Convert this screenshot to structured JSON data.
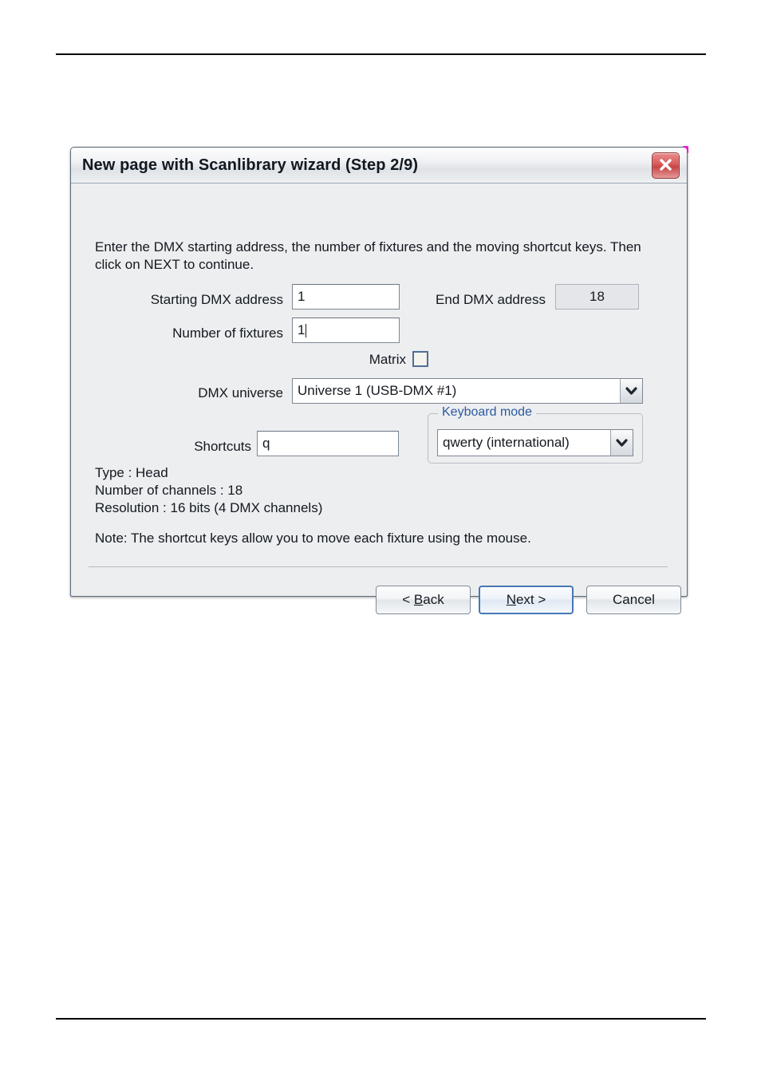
{
  "dialog": {
    "title": "New page with Scanlibrary wizard (Step 2/9)",
    "close_icon": "close-icon",
    "instruction": "Enter the DMX starting address, the number of fixtures and the moving shortcut keys. Then click on NEXT to continue.",
    "fields": {
      "starting_dmx_address": {
        "label": "Starting DMX address",
        "value": "1"
      },
      "end_dmx_address": {
        "label": "End DMX address",
        "value": "18"
      },
      "number_of_fixtures": {
        "label": "Number of fixtures",
        "value": "1",
        "focused": true
      },
      "matrix": {
        "label": "Matrix",
        "checked": false
      },
      "dmx_universe": {
        "label": "DMX universe",
        "value": "Universe  1    (USB-DMX #1)"
      },
      "shortcuts": {
        "label": "Shortcuts",
        "value": "q"
      },
      "keyboard_mode": {
        "group_label": "Keyboard mode",
        "value": "qwerty (international)"
      }
    },
    "info": {
      "type_line": "Type : Head",
      "channels_line": "Number of channels : 18",
      "resolution_line": "Resolution : 16 bits (4 DMX channels)",
      "note_line": "Note: The shortcut keys allow you to move each fixture using the mouse."
    },
    "buttons": {
      "back_prefix": "< ",
      "back_accel": "B",
      "back_suffix": "ack",
      "next_accel": "N",
      "next_suffix": "ext >",
      "cancel": "Cancel"
    },
    "colors": {
      "accent_blue": "#2c5aa0",
      "default_button_border": "#4878b4",
      "close_red": "#c64444",
      "dialog_background": "#eceef0"
    }
  }
}
